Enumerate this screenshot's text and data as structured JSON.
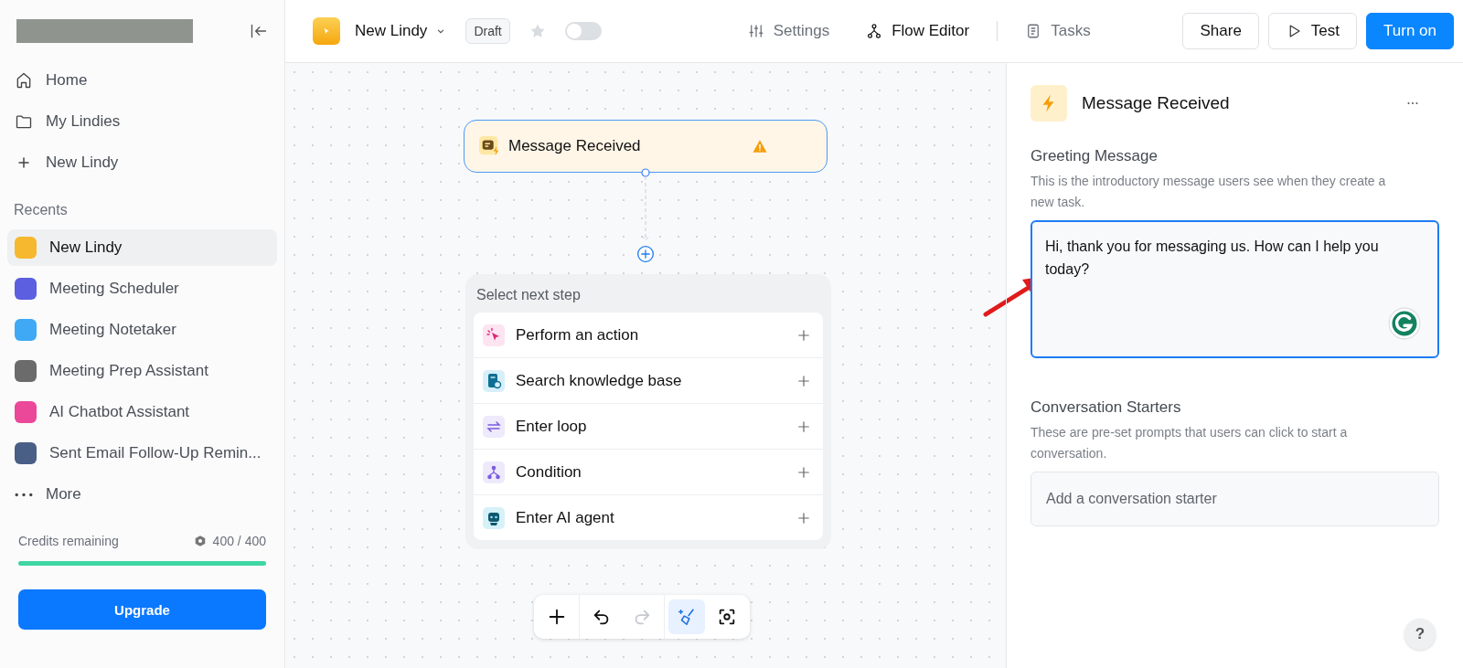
{
  "sidebar": {
    "nav": [
      {
        "kind": "home",
        "label": "Home"
      },
      {
        "kind": "folder",
        "label": "My Lindies"
      },
      {
        "kind": "plus",
        "label": "New Lindy"
      }
    ],
    "recents_title": "Recents",
    "recents": [
      {
        "label": "New Lindy",
        "color": "#f5b82e",
        "selected": true
      },
      {
        "label": "Meeting Scheduler",
        "color": "#5b5fe0",
        "selected": false
      },
      {
        "label": "Meeting Notetaker",
        "color": "#3fa9f5",
        "selected": false
      },
      {
        "label": "Meeting Prep Assistant",
        "color": "#6b6b6b",
        "selected": false
      },
      {
        "label": "AI Chatbot Assistant",
        "color": "#ec4899",
        "selected": false
      },
      {
        "label": "Sent Email Follow-Up Remin...",
        "color": "#4a5f86",
        "selected": false
      }
    ],
    "more": "More",
    "credits": {
      "label": "Credits remaining",
      "value": "400 / 400",
      "level": 1.0
    },
    "upgrade": "Upgrade"
  },
  "header": {
    "title": "New Lindy",
    "badge": "Draft",
    "toggle_on": false,
    "tabs": [
      {
        "kind": "settings",
        "label": "Settings",
        "selected": false
      },
      {
        "kind": "flow",
        "label": "Flow Editor",
        "selected": true
      },
      {
        "kind": "tasks",
        "label": "Tasks",
        "selected": false
      }
    ],
    "buttons": [
      {
        "kind": "plain",
        "label": "Share"
      },
      {
        "kind": "test",
        "label": "Test"
      },
      {
        "kind": "primary",
        "label": "Turn on"
      }
    ]
  },
  "canvas": {
    "trigger": {
      "label": "Message Received",
      "warning": true
    },
    "picker": {
      "title": "Select next step",
      "options": [
        {
          "kind": "action",
          "label": "Perform an action"
        },
        {
          "kind": "knowledge",
          "label": "Search knowledge base"
        },
        {
          "kind": "loop",
          "label": "Enter loop"
        },
        {
          "kind": "condition",
          "label": "Condition"
        },
        {
          "kind": "agent",
          "label": "Enter AI agent"
        }
      ]
    },
    "toolbar": [
      {
        "kind": "add",
        "disabled": false,
        "selected": false
      },
      {
        "kind": "undo",
        "disabled": false,
        "selected": false
      },
      {
        "kind": "redo",
        "disabled": true,
        "selected": false
      },
      {
        "kind": "clean",
        "disabled": false,
        "selected": true
      },
      {
        "kind": "focus",
        "disabled": false,
        "selected": false
      }
    ]
  },
  "panel": {
    "title": "Message Received",
    "greeting": {
      "label": "Greeting Message",
      "help": "This is the introductory message users see when they create a new task.",
      "value": "Hi, thank you for messaging us. How can I help you today?"
    },
    "starters": {
      "label": "Conversation Starters",
      "help": "These are pre-set prompts that users can click to start a conversation.",
      "placeholder": "Add a conversation starter"
    }
  },
  "help_button": "?"
}
